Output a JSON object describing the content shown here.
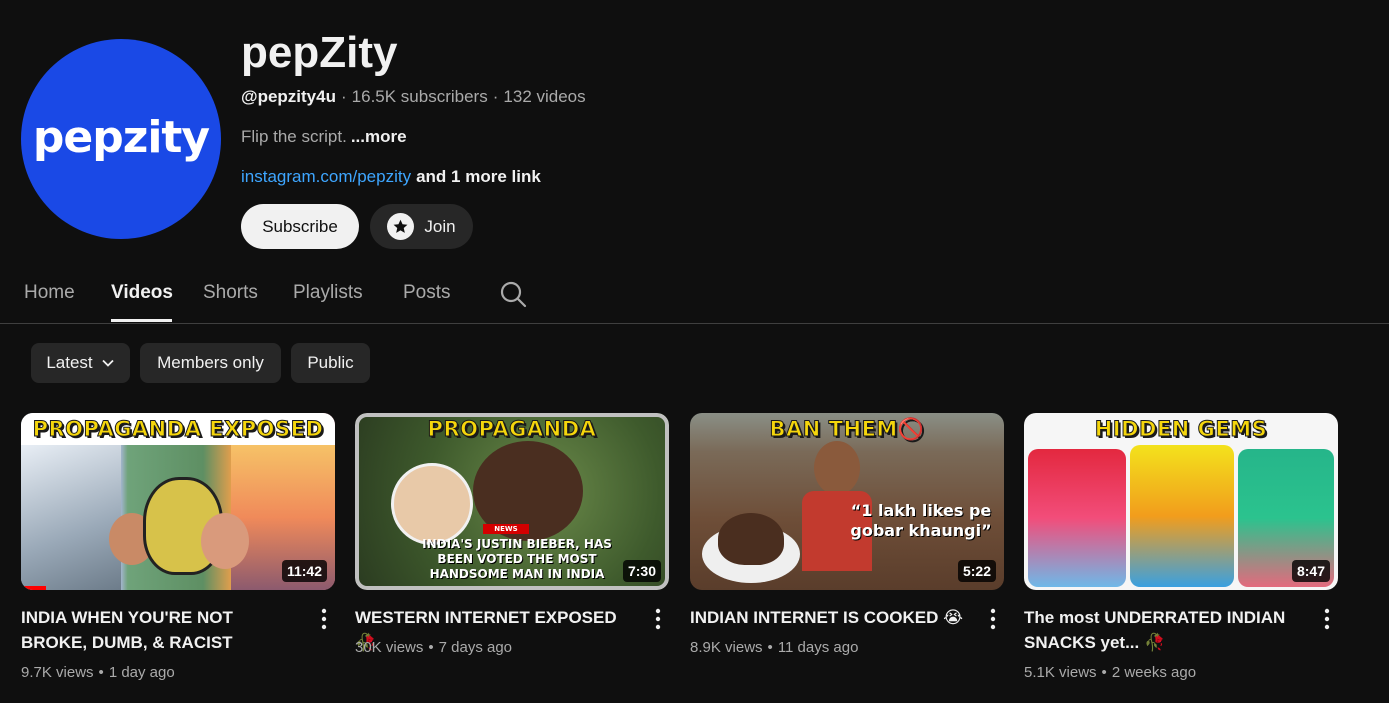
{
  "channel": {
    "avatar_text": "pepzity",
    "name": "pepZity",
    "handle": "@pepzity4u",
    "subscribers": "16.5K subscribers",
    "video_count": "132 videos",
    "description": "Flip the script.",
    "more_label": "...more",
    "link_text": "instagram.com/pepzity",
    "more_links": "and 1 more link",
    "subscribe_label": "Subscribe",
    "join_label": "Join"
  },
  "tabs": {
    "home": "Home",
    "videos": "Videos",
    "shorts": "Shorts",
    "playlists": "Playlists",
    "posts": "Posts"
  },
  "filters": {
    "latest": "Latest",
    "members": "Members only",
    "public": "Public"
  },
  "videos": [
    {
      "thumb_title": "PROPAGANDA EXPOSED",
      "duration": "11:42",
      "title": "INDIA WHEN YOU'RE NOT BROKE, DUMB, & RACIST",
      "views": "9.7K views",
      "age": "1 day ago",
      "progress": 0.08
    },
    {
      "thumb_title": "PROPAGANDA",
      "thumb_news": "NEWS",
      "thumb_caption": "INDIA'S JUSTIN BIEBER, HAS BEEN VOTED THE MOST HANDSOME MAN IN INDIA",
      "duration": "7:30",
      "title": "WESTERN INTERNET EXPOSED🥀",
      "views": "30K views",
      "age": "7 days ago"
    },
    {
      "thumb_title": "BAN THEM🚫",
      "thumb_quote": "“1 lakh likes pe gobar khaungi”",
      "duration": "5:22",
      "title": "INDIAN INTERNET IS COOKED 😭",
      "views": "8.9K views",
      "age": "11 days ago"
    },
    {
      "thumb_title": "HIDDEN GEMS",
      "duration": "8:47",
      "title": "The most UNDERRATED INDIAN SNACKS yet... 🥀",
      "views": "5.1K views",
      "age": "2 weeks ago"
    }
  ]
}
